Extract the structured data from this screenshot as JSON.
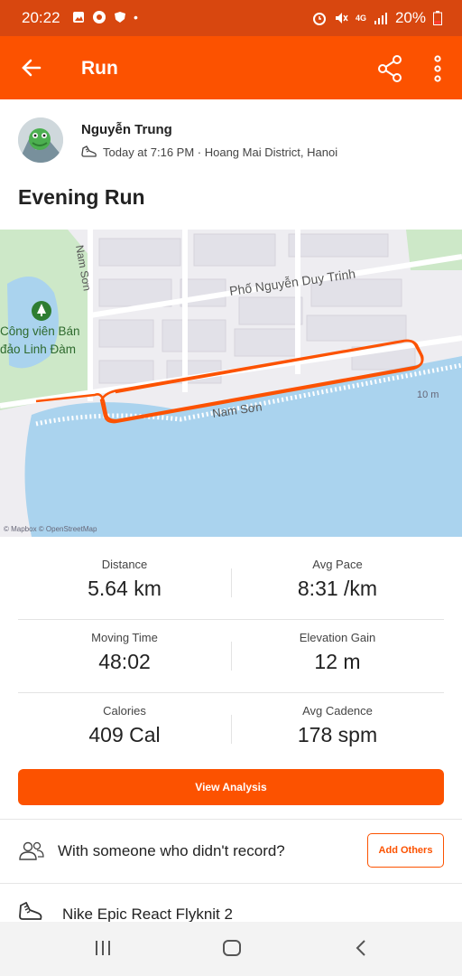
{
  "status_bar": {
    "time": "20:22",
    "battery": "20%",
    "network": "4G"
  },
  "app_bar": {
    "title": "Run",
    "accent": "#fc5200"
  },
  "activity": {
    "athlete_name": "Nguyễn Trung",
    "meta": "Today at 7:16 PM · Hoang Mai District, Hanoi",
    "title": "Evening Run"
  },
  "map": {
    "labels": {
      "street_main": "Phố Nguyễn Duy Trinh",
      "street_side": "Nam Sơn",
      "street_bottom": "Nam Sơn",
      "park_line1": "Công viên Bán",
      "park_line2": "đảo Linh Đàm",
      "scale": "10 m",
      "attribution": "© Mapbox © OpenStreetMap"
    },
    "route_color": "#fc5200"
  },
  "stats": [
    {
      "label": "Distance",
      "value": "5.64 km"
    },
    {
      "label": "Avg Pace",
      "value": "8:31 /km"
    },
    {
      "label": "Moving Time",
      "value": "48:02"
    },
    {
      "label": "Elevation Gain",
      "value": "12 m"
    },
    {
      "label": "Calories",
      "value": "409 Cal"
    },
    {
      "label": "Avg Cadence",
      "value": "178 spm"
    }
  ],
  "actions": {
    "view_analysis": "View Analysis",
    "with_someone": "With someone who didn't record?",
    "add_others": "Add Others",
    "gear": "Nike Epic React Flyknit 2"
  }
}
